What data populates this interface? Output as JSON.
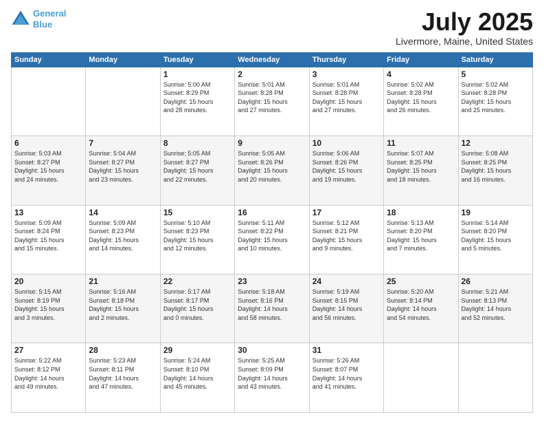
{
  "header": {
    "logo_line1": "General",
    "logo_line2": "Blue",
    "month": "July 2025",
    "location": "Livermore, Maine, United States"
  },
  "weekdays": [
    "Sunday",
    "Monday",
    "Tuesday",
    "Wednesday",
    "Thursday",
    "Friday",
    "Saturday"
  ],
  "weeks": [
    [
      {
        "day": "",
        "info": ""
      },
      {
        "day": "",
        "info": ""
      },
      {
        "day": "1",
        "info": "Sunrise: 5:00 AM\nSunset: 8:29 PM\nDaylight: 15 hours\nand 28 minutes."
      },
      {
        "day": "2",
        "info": "Sunrise: 5:01 AM\nSunset: 8:28 PM\nDaylight: 15 hours\nand 27 minutes."
      },
      {
        "day": "3",
        "info": "Sunrise: 5:01 AM\nSunset: 8:28 PM\nDaylight: 15 hours\nand 27 minutes."
      },
      {
        "day": "4",
        "info": "Sunrise: 5:02 AM\nSunset: 8:28 PM\nDaylight: 15 hours\nand 26 minutes."
      },
      {
        "day": "5",
        "info": "Sunrise: 5:02 AM\nSunset: 8:28 PM\nDaylight: 15 hours\nand 25 minutes."
      }
    ],
    [
      {
        "day": "6",
        "info": "Sunrise: 5:03 AM\nSunset: 8:27 PM\nDaylight: 15 hours\nand 24 minutes."
      },
      {
        "day": "7",
        "info": "Sunrise: 5:04 AM\nSunset: 8:27 PM\nDaylight: 15 hours\nand 23 minutes."
      },
      {
        "day": "8",
        "info": "Sunrise: 5:05 AM\nSunset: 8:27 PM\nDaylight: 15 hours\nand 22 minutes."
      },
      {
        "day": "9",
        "info": "Sunrise: 5:05 AM\nSunset: 8:26 PM\nDaylight: 15 hours\nand 20 minutes."
      },
      {
        "day": "10",
        "info": "Sunrise: 5:06 AM\nSunset: 8:26 PM\nDaylight: 15 hours\nand 19 minutes."
      },
      {
        "day": "11",
        "info": "Sunrise: 5:07 AM\nSunset: 8:25 PM\nDaylight: 15 hours\nand 18 minutes."
      },
      {
        "day": "12",
        "info": "Sunrise: 5:08 AM\nSunset: 8:25 PM\nDaylight: 15 hours\nand 16 minutes."
      }
    ],
    [
      {
        "day": "13",
        "info": "Sunrise: 5:09 AM\nSunset: 8:24 PM\nDaylight: 15 hours\nand 15 minutes."
      },
      {
        "day": "14",
        "info": "Sunrise: 5:09 AM\nSunset: 8:23 PM\nDaylight: 15 hours\nand 14 minutes."
      },
      {
        "day": "15",
        "info": "Sunrise: 5:10 AM\nSunset: 8:23 PM\nDaylight: 15 hours\nand 12 minutes."
      },
      {
        "day": "16",
        "info": "Sunrise: 5:11 AM\nSunset: 8:22 PM\nDaylight: 15 hours\nand 10 minutes."
      },
      {
        "day": "17",
        "info": "Sunrise: 5:12 AM\nSunset: 8:21 PM\nDaylight: 15 hours\nand 9 minutes."
      },
      {
        "day": "18",
        "info": "Sunrise: 5:13 AM\nSunset: 8:20 PM\nDaylight: 15 hours\nand 7 minutes."
      },
      {
        "day": "19",
        "info": "Sunrise: 5:14 AM\nSunset: 8:20 PM\nDaylight: 15 hours\nand 5 minutes."
      }
    ],
    [
      {
        "day": "20",
        "info": "Sunrise: 5:15 AM\nSunset: 8:19 PM\nDaylight: 15 hours\nand 3 minutes."
      },
      {
        "day": "21",
        "info": "Sunrise: 5:16 AM\nSunset: 8:18 PM\nDaylight: 15 hours\nand 2 minutes."
      },
      {
        "day": "22",
        "info": "Sunrise: 5:17 AM\nSunset: 8:17 PM\nDaylight: 15 hours\nand 0 minutes."
      },
      {
        "day": "23",
        "info": "Sunrise: 5:18 AM\nSunset: 8:16 PM\nDaylight: 14 hours\nand 58 minutes."
      },
      {
        "day": "24",
        "info": "Sunrise: 5:19 AM\nSunset: 8:15 PM\nDaylight: 14 hours\nand 56 minutes."
      },
      {
        "day": "25",
        "info": "Sunrise: 5:20 AM\nSunset: 8:14 PM\nDaylight: 14 hours\nand 54 minutes."
      },
      {
        "day": "26",
        "info": "Sunrise: 5:21 AM\nSunset: 8:13 PM\nDaylight: 14 hours\nand 52 minutes."
      }
    ],
    [
      {
        "day": "27",
        "info": "Sunrise: 5:22 AM\nSunset: 8:12 PM\nDaylight: 14 hours\nand 49 minutes."
      },
      {
        "day": "28",
        "info": "Sunrise: 5:23 AM\nSunset: 8:11 PM\nDaylight: 14 hours\nand 47 minutes."
      },
      {
        "day": "29",
        "info": "Sunrise: 5:24 AM\nSunset: 8:10 PM\nDaylight: 14 hours\nand 45 minutes."
      },
      {
        "day": "30",
        "info": "Sunrise: 5:25 AM\nSunset: 8:09 PM\nDaylight: 14 hours\nand 43 minutes."
      },
      {
        "day": "31",
        "info": "Sunrise: 5:26 AM\nSunset: 8:07 PM\nDaylight: 14 hours\nand 41 minutes."
      },
      {
        "day": "",
        "info": ""
      },
      {
        "day": "",
        "info": ""
      }
    ]
  ]
}
